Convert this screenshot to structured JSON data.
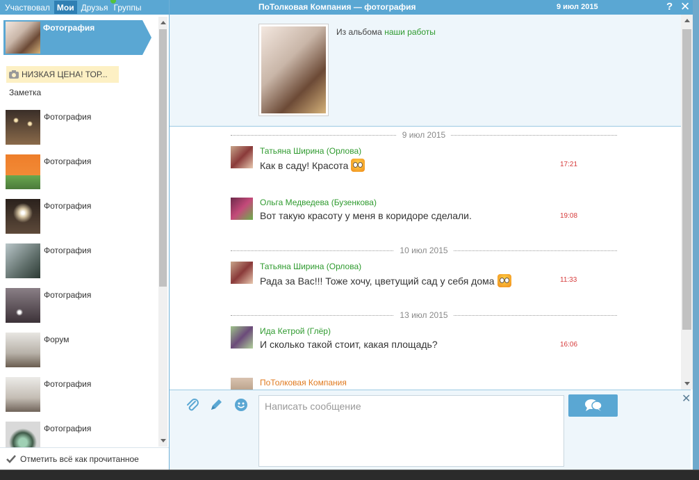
{
  "left_tabs": [
    {
      "label": "Участвовал"
    },
    {
      "label": "Мои"
    },
    {
      "label": "Друзья"
    },
    {
      "label": "Группы"
    }
  ],
  "left_list": {
    "active_item": {
      "label": "Фотография"
    },
    "note": {
      "text": "НИЗКАЯ ЦЕНА! ТОР...",
      "type": "Заметка"
    },
    "items": [
      {
        "label": "Фотография"
      },
      {
        "label": "Фотография"
      },
      {
        "label": "Фотография"
      },
      {
        "label": "Фотография"
      },
      {
        "label": "Фотография"
      },
      {
        "label": "Форум"
      },
      {
        "label": "Фотография"
      },
      {
        "label": "Фотография"
      }
    ]
  },
  "mark_all_read": "Отметить всё как прочитанное",
  "titlebar": {
    "title": "ПоТолковая Компания — фотография",
    "date": "9 июл 2015",
    "help": "?",
    "close": "✕"
  },
  "album": {
    "prefix": "Из альбома",
    "name": "наши работы"
  },
  "chat": {
    "separators": [
      "9 июл 2015",
      "10 июл 2015",
      "13 июл 2015"
    ],
    "messages": [
      {
        "author": "Татьяна Ширина (Орлова)",
        "text": "Как в саду! Красота",
        "time": "17:21",
        "smiley": true
      },
      {
        "author": "Ольга Медведева (Бузенкова)",
        "text": "Вот такую красоту у меня в коридоре сделали.",
        "time": "19:08",
        "smiley": false
      },
      {
        "author": "Татьяна Ширина (Орлова)",
        "text": "Рада за Вас!!! Тоже хочу, цветущий сад у себя дома",
        "time": "11:33",
        "smiley": true
      },
      {
        "author": "Ида Кетрой (Глёр)",
        "text": "И сколько такой стоит, какая площадь?",
        "time": "16:06",
        "smiley": false
      },
      {
        "author": "ПоТолковая Компания",
        "text": "",
        "time": "",
        "smiley": false
      }
    ]
  },
  "composer": {
    "placeholder": "Написать сообщение",
    "close": "✕"
  },
  "colors": {
    "accent": "#5aa7d3",
    "author_green": "#2e9a2e",
    "company_orange": "#e07a1f",
    "time_red": "#d63a3a"
  }
}
